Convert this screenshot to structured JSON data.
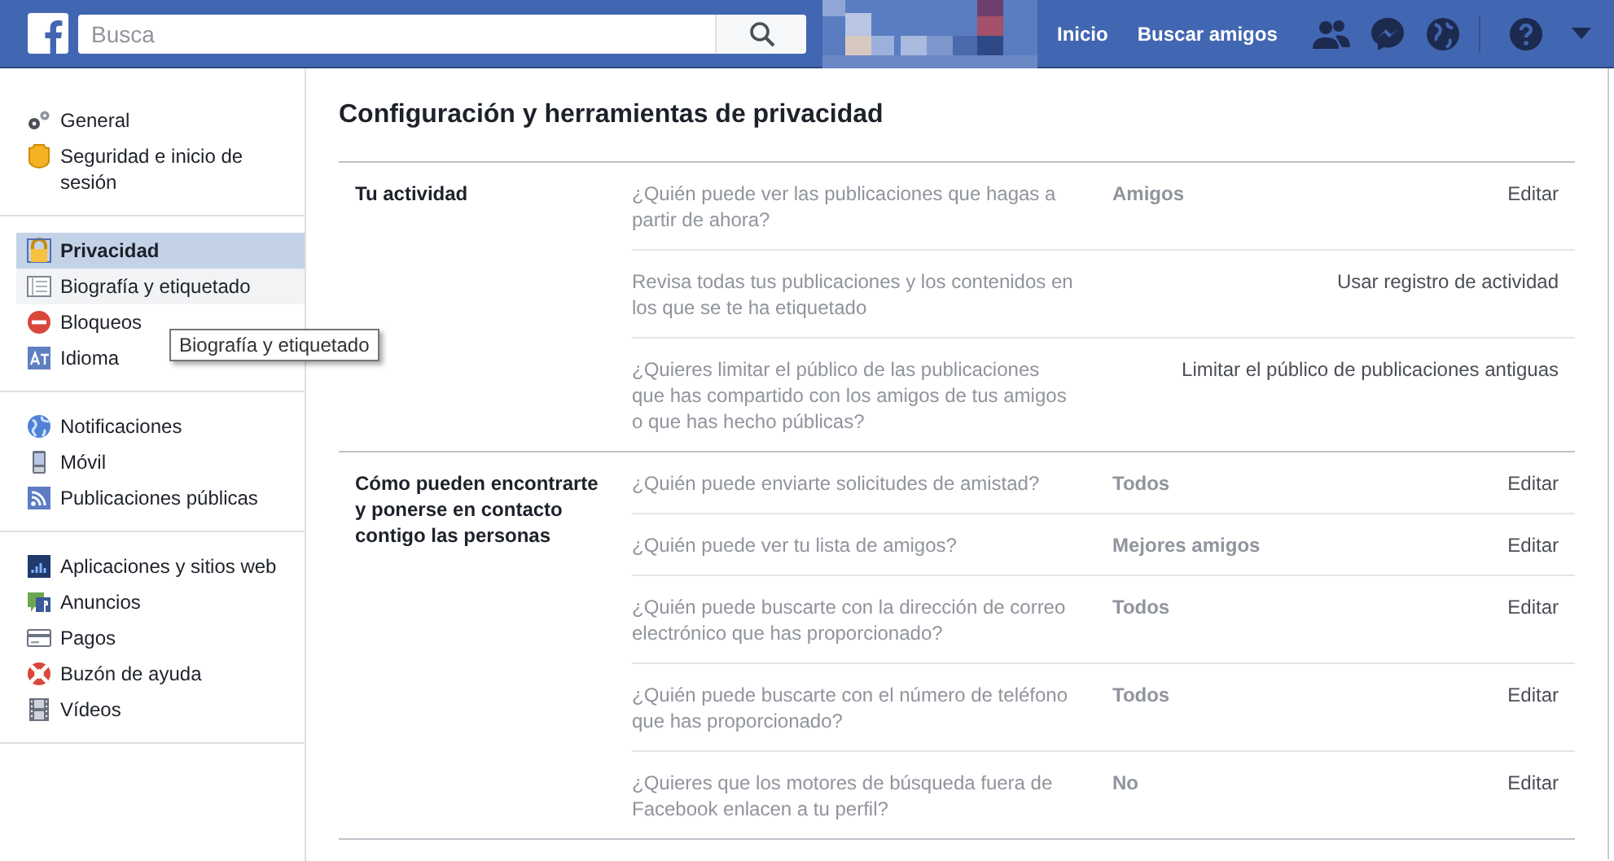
{
  "header": {
    "search": {
      "placeholder": "Busca"
    },
    "nav": [
      {
        "label": "Inicio"
      },
      {
        "label": "Buscar amigos"
      }
    ]
  },
  "sidebar": {
    "groups": [
      {
        "items": [
          {
            "label": "General",
            "selected": false,
            "hovered": false
          },
          {
            "label": "Seguridad e inicio de sesión",
            "selected": false,
            "hovered": false
          }
        ]
      },
      {
        "items": [
          {
            "label": "Privacidad",
            "selected": true,
            "hovered": false
          },
          {
            "label": "Biografía y etiquetado",
            "selected": false,
            "hovered": true
          },
          {
            "label": "Bloqueos",
            "selected": false,
            "hovered": false
          },
          {
            "label": "Idioma",
            "selected": false,
            "hovered": false
          }
        ]
      },
      {
        "items": [
          {
            "label": "Notificaciones",
            "selected": false,
            "hovered": false
          },
          {
            "label": "Móvil",
            "selected": false,
            "hovered": false
          },
          {
            "label": "Publicaciones públicas",
            "selected": false,
            "hovered": false
          }
        ]
      },
      {
        "items": [
          {
            "label": "Aplicaciones y sitios web",
            "selected": false,
            "hovered": false
          },
          {
            "label": "Anuncios",
            "selected": false,
            "hovered": false
          },
          {
            "label": "Pagos",
            "selected": false,
            "hovered": false
          },
          {
            "label": "Buzón de ayuda",
            "selected": false,
            "hovered": false
          },
          {
            "label": "Vídeos",
            "selected": false,
            "hovered": false
          }
        ]
      }
    ],
    "tooltip": "Biografía y etiquetado"
  },
  "main": {
    "title": "Configuración y herramientas de privacidad",
    "sections": [
      {
        "label": "Tu actividad",
        "rows": [
          {
            "question": "¿Quién puede ver las publicaciones que hagas a partir de ahora?",
            "value": "Amigos",
            "action": "Editar"
          },
          {
            "question": "Revisa todas tus publicaciones y los contenidos en los que se te ha etiquetado",
            "action": "Usar registro de actividad"
          },
          {
            "question": "¿Quieres limitar el público de las publicaciones que has compartido con los amigos de tus amigos o que has hecho públicas?",
            "action": "Limitar el público de publicaciones antiguas"
          }
        ]
      },
      {
        "label": "Cómo pueden encontrarte y ponerse en contacto contigo las personas",
        "rows": [
          {
            "question": "¿Quién puede enviarte solicitudes de amistad?",
            "value": "Todos",
            "action": "Editar"
          },
          {
            "question": "¿Quién puede ver tu lista de amigos?",
            "value": "Mejores amigos",
            "action": "Editar"
          },
          {
            "question": "¿Quién puede buscarte con la dirección de correo electrónico que has proporcionado?",
            "value": "Todos",
            "action": "Editar"
          },
          {
            "question": "¿Quién puede buscarte con el número de teléfono que has proporcionado?",
            "value": "Todos",
            "action": "Editar"
          },
          {
            "question": "¿Quieres que los motores de búsqueda fuera de Facebook enlacen a tu perfil?",
            "value": "No",
            "action": "Editar"
          }
        ]
      }
    ]
  }
}
